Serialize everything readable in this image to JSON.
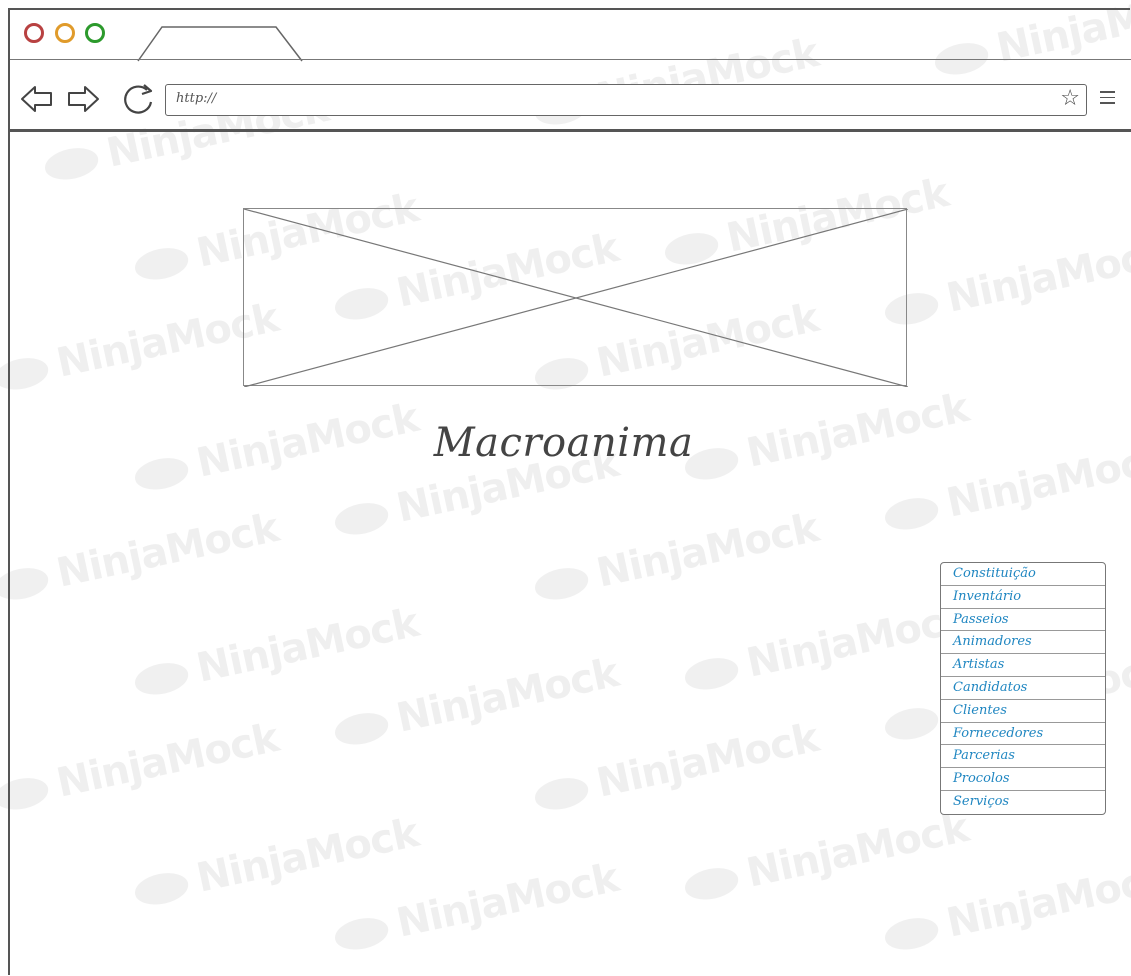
{
  "browser": {
    "url": "http://",
    "window_controls": [
      "close",
      "minimize",
      "maximize"
    ],
    "tab_label": ""
  },
  "watermark": {
    "text": "NinjaMock"
  },
  "page": {
    "title": "Macroanima"
  },
  "side_menu": {
    "items": [
      {
        "label": "Constituição"
      },
      {
        "label": "Inventário"
      },
      {
        "label": "Passeios"
      },
      {
        "label": "Animadores"
      },
      {
        "label": "Artistas"
      },
      {
        "label": "Candidatos"
      },
      {
        "label": "Clientes"
      },
      {
        "label": "Fornecedores"
      },
      {
        "label": "Parcerias"
      },
      {
        "label": "Procolos"
      },
      {
        "label": "Serviços"
      }
    ]
  },
  "colors": {
    "close": "#b84141",
    "minimize": "#e09b2b",
    "maximize": "#2c9a2c",
    "link": "#1f86c1",
    "watermark": "#efefef"
  },
  "icons": [
    "back-arrow-icon",
    "forward-arrow-icon",
    "reload-icon",
    "star-icon",
    "hamburger-menu-icon"
  ]
}
